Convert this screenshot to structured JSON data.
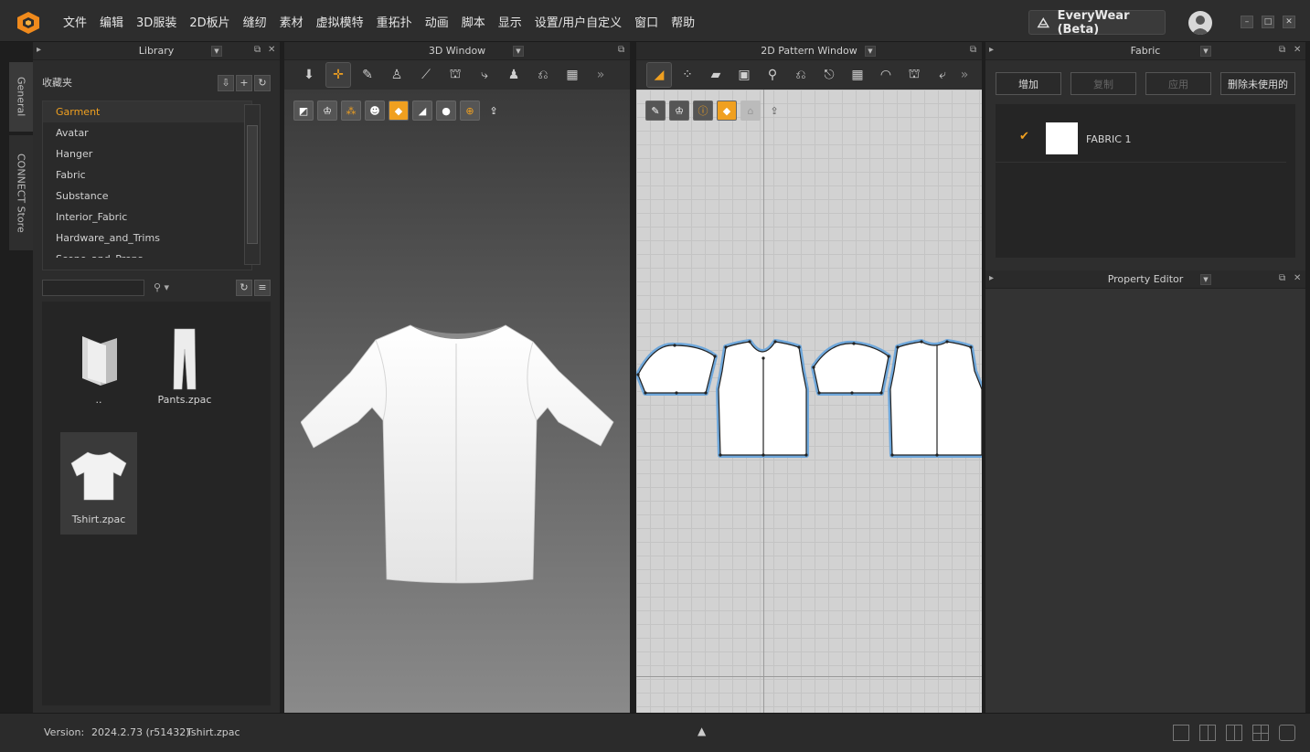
{
  "app": {
    "menu": [
      "文件",
      "编辑",
      "3D服装",
      "2D板片",
      "缝纫",
      "素材",
      "虚拟模特",
      "重拓扑",
      "动画",
      "脚本",
      "显示",
      "设置/用户自定义",
      "窗口",
      "帮助"
    ],
    "brand_button": "EveryWear (Beta)",
    "window_controls": [
      "minimize",
      "maximize",
      "close"
    ]
  },
  "side_tabs": [
    "General",
    "CONNECT Store"
  ],
  "library": {
    "title": "Library",
    "favorites_label": "收藏夹",
    "folders": [
      "Garment",
      "Avatar",
      "Hanger",
      "Fabric",
      "Substance",
      "Interior_Fabric",
      "Hardware_and_Trims",
      "Scene_and_Props"
    ],
    "selected_folder": "Garment",
    "search": {
      "value": "",
      "placeholder": ""
    },
    "files": [
      {
        "name": "..",
        "icon": "folder-icon"
      },
      {
        "name": "Pants.zpac",
        "icon": "pants-icon"
      },
      {
        "name": "Tshirt.zpac",
        "icon": "tshirt-icon",
        "selected": true
      }
    ]
  },
  "window3d": {
    "title": "3D Window",
    "toolbar": [
      "select-mesh-icon",
      "move-icon",
      "edit-icon",
      "simulate-icon",
      "tack-icon",
      "fold-icon",
      "arrange-icon",
      "avatar-icon",
      "pin-icon",
      "grid-icon"
    ],
    "subtoolbar": [
      "texture-icon",
      "garment-icon",
      "points-icon",
      "avatar-show-icon",
      "fabric-icon",
      "surface-icon",
      "avatar-head-icon",
      "globe-icon",
      "export-icon"
    ]
  },
  "window2d": {
    "title": "2D Pattern Window",
    "toolbar": [
      "transform-pattern-icon",
      "edit-points-icon",
      "polygon-icon",
      "rectangle-icon",
      "internal-icon",
      "sewing-icon",
      "sewing-free-icon",
      "grid-icon",
      "fold-icon",
      "topstitch-icon",
      "needle-icon"
    ],
    "subtoolbar": [
      "pencil-eye-icon",
      "shirt-eye-icon",
      "info-eye-icon",
      "fabric-texture-icon",
      "building-icon",
      "export-icon"
    ]
  },
  "fabric": {
    "title": "Fabric",
    "buttons": [
      {
        "label": "增加",
        "enabled": true
      },
      {
        "label": "复制",
        "enabled": false
      },
      {
        "label": "应用",
        "enabled": false
      },
      {
        "label": "删除未使用的",
        "enabled": true
      }
    ],
    "items": [
      {
        "name": "FABRIC 1",
        "checked": true,
        "swatch_color": "#ffffff"
      }
    ]
  },
  "property_editor": {
    "title": "Property Editor"
  },
  "status": {
    "version_label": "Version:",
    "version": "2024.2.73 (r51432)",
    "file": "Tshirt.zpac"
  },
  "colors": {
    "accent": "#f0a020",
    "pattern_outline": "#6fa8dc"
  }
}
